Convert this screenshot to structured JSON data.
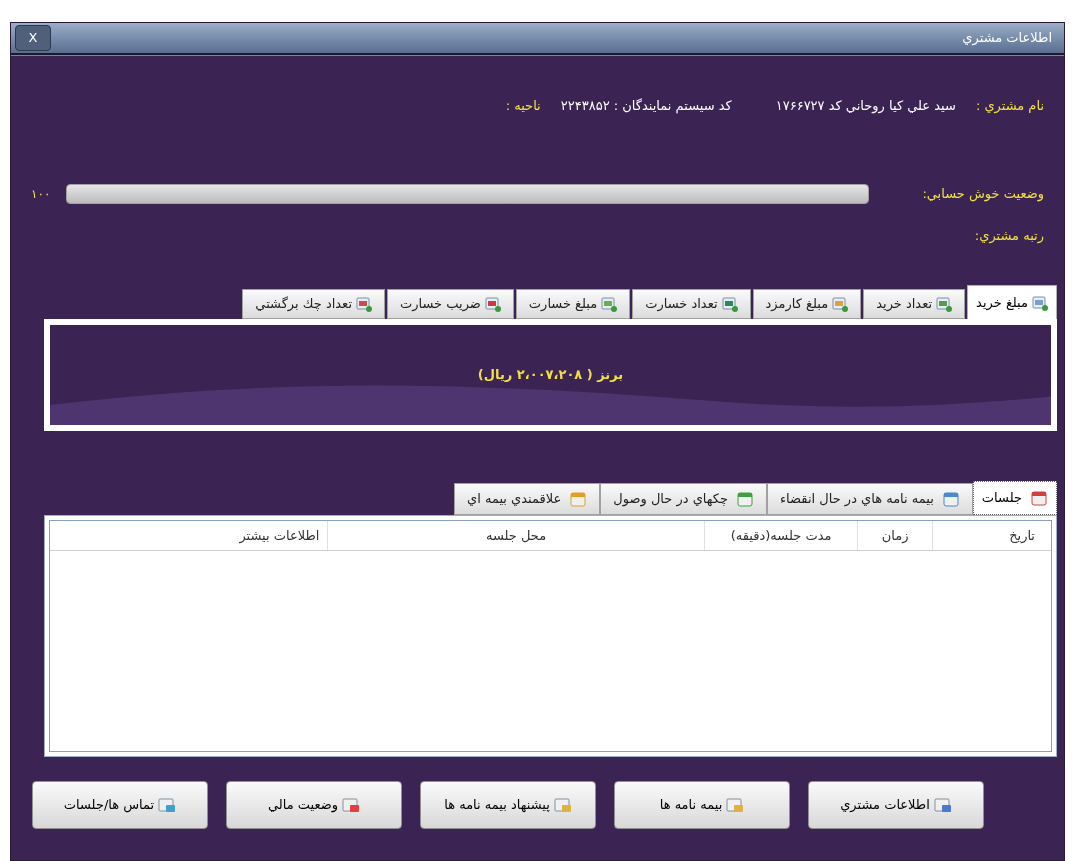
{
  "window": {
    "title": "اطلاعات مشتري",
    "close": "X"
  },
  "customer": {
    "name_label": "نام مشتري :",
    "name_value": "سيد علي كيا روحاني كد ۱۷۶۶۷۲۷",
    "agent_code": "كد سيستم نمايندگان : ۲۲۴۳۸۵۲",
    "region_label": "ناحيه :"
  },
  "credit": {
    "label": "وضعيت خوش حسابي:",
    "level": 1,
    "reading": "۱۰۰"
  },
  "rank": {
    "label": "رتبه مشتري:"
  },
  "stat_tabs": [
    {
      "label": "مبلغ خريد",
      "selected": true
    },
    {
      "label": "تعداد خريد",
      "selected": false
    },
    {
      "label": "مبلغ كارمزد",
      "selected": false
    },
    {
      "label": "تعداد خسارت",
      "selected": false
    },
    {
      "label": "مبلغ خسارت",
      "selected": false
    },
    {
      "label": "ضريب خسارت",
      "selected": false
    },
    {
      "label": "تعداد چك برگشتي",
      "selected": false
    }
  ],
  "stat_panel": {
    "text": "برنز ( ۲،۰۰۷،۲۰۸ ريال)"
  },
  "detail_tabs": [
    {
      "label": "جلسات",
      "selected": true
    },
    {
      "label": "بيمه نامه هاي در حال انقضاء",
      "selected": false
    },
    {
      "label": "چكهاي در حال وصول",
      "selected": false
    },
    {
      "label": "علاقمندي بيمه اي",
      "selected": false
    }
  ],
  "table": {
    "columns": [
      "تاريخ",
      "زمان",
      "مدت جلسه(دقيقه)",
      "محل جلسه",
      "اطلاعات بيشتر"
    ]
  },
  "buttons": [
    "اطلاعات مشتري",
    "بيمه نامه ها",
    "پيشنهاد بيمه نامه ها",
    "وضعيت مالي",
    "تماس ها/جلسات"
  ]
}
